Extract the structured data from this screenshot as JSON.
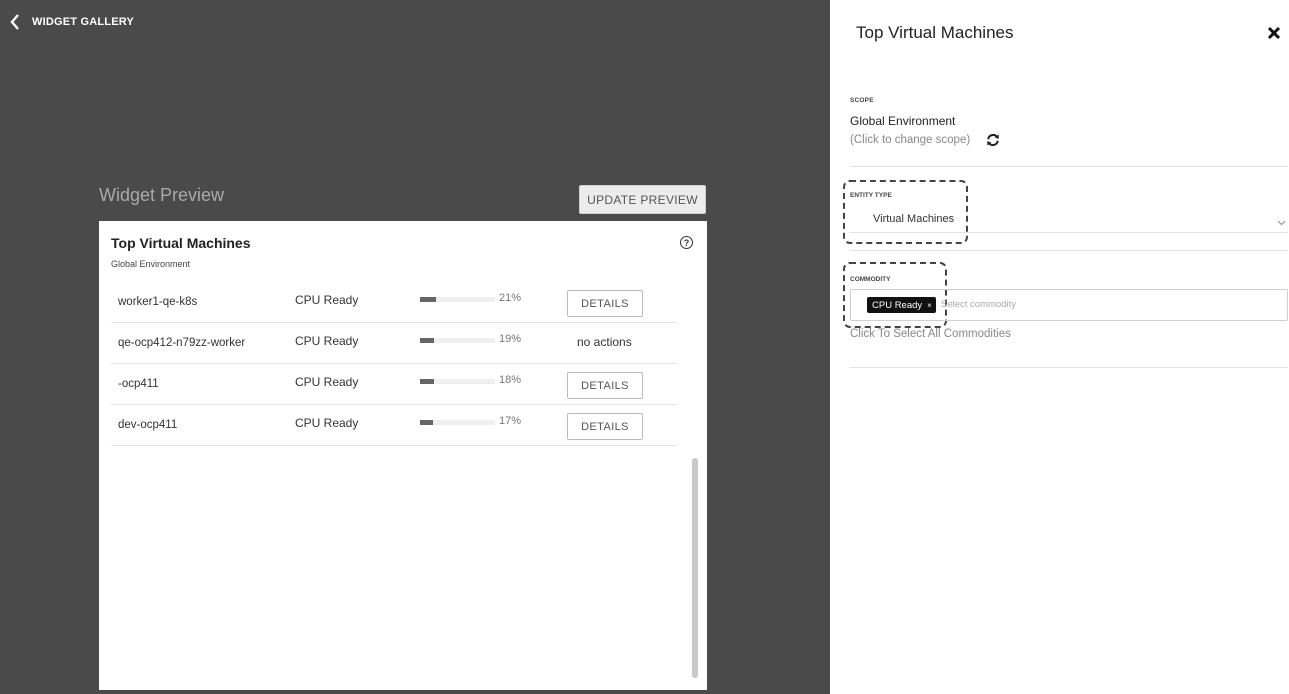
{
  "gallery": {
    "title": "WIDGET GALLERY",
    "back_icon": "chevron-left-icon"
  },
  "preview": {
    "title": "Widget Preview",
    "update_button": "UPDATE PREVIEW"
  },
  "widget": {
    "title": "Top Virtual Machines",
    "subtitle": "Global Environment",
    "help_icon": "?",
    "rows": [
      {
        "name": "worker1-qe-k8s",
        "commodity": "CPU Ready",
        "percent": 21,
        "percent_label": "21%",
        "action": "DETAILS"
      },
      {
        "name": "qe-ocp412-n79zz-worker",
        "commodity": "CPU Ready",
        "percent": 19,
        "percent_label": "19%",
        "action": "no actions"
      },
      {
        "name": "-ocp411",
        "commodity": "CPU Ready",
        "percent": 18,
        "percent_label": "18%",
        "action": "DETAILS"
      },
      {
        "name": "dev-ocp411",
        "commodity": "CPU Ready",
        "percent": 17,
        "percent_label": "17%",
        "action": "DETAILS"
      }
    ]
  },
  "panel": {
    "title": "Top Virtual Machines",
    "close_icon": "close-icon",
    "scope": {
      "label": "SCOPE",
      "value": "Global Environment",
      "change_text": "(Click to change scope)"
    },
    "entity_type": {
      "label": "ENTITY TYPE",
      "value": "Virtual Machines"
    },
    "commodity": {
      "label": "COMMODITY",
      "chip": "CPU Ready",
      "chip_remove": "×",
      "placeholder": "Select commodity",
      "select_all": "Click To Select All Commodities"
    }
  },
  "colors": {
    "gallery_bg": "#4a4a4a",
    "chip_bg": "#111111",
    "bar_fill": "#666666"
  }
}
